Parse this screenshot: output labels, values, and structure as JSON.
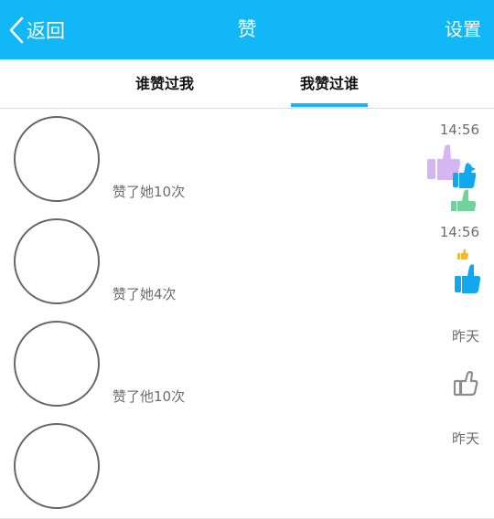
{
  "header": {
    "back_label": "返回",
    "title": "赞",
    "settings_label": "设置",
    "background": "#12b7f5"
  },
  "tabs": [
    {
      "label": "谁赞过我",
      "active": false
    },
    {
      "label": "我赞过谁",
      "active": true
    }
  ],
  "list": [
    {
      "desc": "赞了她10次",
      "time": "14:56",
      "icon": "colorful-thumbs-up-icon"
    },
    {
      "desc": "赞了她4次",
      "time": "14:56",
      "icon": "blue-thumbs-up-icon"
    },
    {
      "desc": "赞了他10次",
      "time": "昨天",
      "icon": "outline-thumbs-up-icon"
    },
    {
      "time": "昨天"
    }
  ]
}
